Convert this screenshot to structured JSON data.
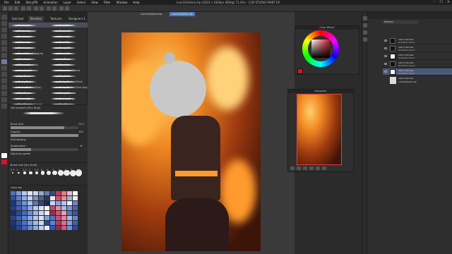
{
  "window": {
    "title": "Lum1024shd.clip (1024 x 1920px 400dpi 71.4%) - CLIP STUDIO PAINT EX",
    "menu": [
      "File",
      "Edit",
      "Story/PS",
      "Animation",
      "Layer",
      "Select",
      "View",
      "Filter",
      "Window",
      "Help"
    ],
    "controls": [
      "–",
      "☐",
      "✕"
    ]
  },
  "document_tabs": [
    {
      "label": "Lum1024shd.clip",
      "active": false
    },
    {
      "label": "Lum1024shd.clip",
      "active": true
    }
  ],
  "subtool": {
    "tabs": [
      "Sub tool",
      "Brushes",
      "Textures",
      "Designers 1"
    ],
    "active_tab": "Brushes",
    "brushes": [
      {
        "left": "Texture",
        "right": "Paint Brush"
      },
      {
        "left": "Flattening pen",
        "right": "Pointed Pen"
      },
      {
        "left": "Rough pen",
        "right": "Gouache"
      },
      {
        "left": "Oil paint",
        "right": "Fine Oil"
      },
      {
        "left": "Textured pen",
        "right": "Rough Pen"
      },
      {
        "left": "Brush Pen (Opaque)",
        "right": "Brush Pen"
      },
      {
        "left": "Brush",
        "right": "Ink Pen"
      },
      {
        "left": "Glossy Scratchy",
        "right": "Dry Ink"
      },
      {
        "left": "Unmixed Dense",
        "right": "Saturated Dense"
      },
      {
        "left": "Dry Gouache",
        "right": "Dry Gum"
      },
      {
        "left": "Dotty Dotter",
        "right": "Dotty Dotter (Fine)"
      },
      {
        "left": "Dotty Dotter (Dyn)",
        "right": "Dotty Dotter (Fine dyn)"
      },
      {
        "left": "Dry Gum",
        "right": "Rough Smear"
      },
      {
        "left": "Smear (Fine)",
        "right": "Smear (Dry)"
      },
      {
        "left": "Dry Blender (Large)",
        "right": "Dry Blender"
      },
      {
        "left": "Dry Dust",
        "right": "Dry Dust"
      }
    ]
  },
  "tool_property": {
    "title": "Tool property [Dry Dust]",
    "brush_size_label": "Brush Size",
    "brush_size_value": "79.2",
    "opacity_label": "Opacity",
    "opacity_value": "100",
    "opacity_level": 1.0,
    "brush_size_level": 0.79,
    "antialias_label": "Anti-aliasing",
    "stabilization_label": "Stabilization",
    "stabilization_value": "8",
    "adjust_label": "Adjust by speed"
  },
  "brush_size_panel": {
    "title": "Brush size [Dry Dust]",
    "sizes": [
      "0.7",
      "1",
      "1.5",
      "2",
      "2.5",
      "3",
      "4",
      "5",
      "6",
      "7",
      "8",
      "10"
    ]
  },
  "color_set": {
    "title": "Color set",
    "colors": [
      "#4e6fbf",
      "#7f9bd8",
      "#b8c9ec",
      "#e0e6f6",
      "#c7d5f0",
      "#9aa8c8",
      "#6b7ba6",
      "#3e4a75",
      "#c23b58",
      "#e07a8f",
      "#f1b8c4",
      "#ffffff",
      "#2f4ea0",
      "#5c7fd0",
      "#8faee6",
      "#bfd3f3",
      "#7a8fc4",
      "#4e5f96",
      "#2a3666",
      "#e0e7f7",
      "#d14f6f",
      "#ef8aa0",
      "#9bb3e6",
      "#eef3fb",
      "#1f3a7a",
      "#4668b5",
      "#6f92d6",
      "#a6c0ed",
      "#5f74b0",
      "#35457e",
      "#1c2750",
      "#c9d6f2",
      "#8aa3dd",
      "#b4c6ee",
      "#e5ecf9",
      "#6c84c7",
      "#293f8c",
      "#3d5dad",
      "#5a7ccb",
      "#8aa6e2",
      "#b6caf0",
      "#d8e3f7",
      "#f0f4fc",
      "#c14b6a",
      "#e28aa0",
      "#a8bcea",
      "#7c95d4",
      "#4d66ae",
      "#1b2f66",
      "#30498f",
      "#4a68b8",
      "#6f8fd3",
      "#9eb6e8",
      "#cdd9f4",
      "#e9eefa",
      "#9b2f4d",
      "#c65a77",
      "#ec9fb3",
      "#5676c1",
      "#3a56a0",
      "#26458f",
      "#3b62b8",
      "#5b83d4",
      "#88a7e3",
      "#b3c8ef",
      "#dde6f8",
      "#7ea0e0",
      "#4e75c6",
      "#d34c78",
      "#f07ea1",
      "#a3b9ec",
      "#6a86cd",
      "#1e3578",
      "#2f52a6",
      "#4d73c9",
      "#739ade",
      "#9fbde9",
      "#c9d8f3",
      "#2846a0",
      "#5f83d3",
      "#b03e62",
      "#e36c91",
      "#86a2e0",
      "#3f60b5",
      "#1a2c63",
      "#2a468f",
      "#4466b6",
      "#6689d0",
      "#8eaee4",
      "#b9cdf0",
      "#e4ebf9",
      "#3758ae",
      "#912c4d",
      "#cc5b7e",
      "#718fd7",
      "#2d4b9d"
    ]
  },
  "color_wheel": {
    "title": "Color Wheel",
    "current_color": "#d4142a"
  },
  "navigator": {
    "title": "Navigator"
  },
  "layers": {
    "blend_mode": "Normal",
    "items": [
      {
        "line1": "100 % Normal",
        "line2": "Gradient map 2",
        "thumb": "black",
        "selected": false
      },
      {
        "line1": "100 % Normal",
        "line2": "Gradient map 3",
        "thumb": "black",
        "selected": false
      },
      {
        "line1": "100 % Normal",
        "line2": "Gradient map 1",
        "thumb": "white",
        "selected": false
      },
      {
        "line1": "100 % Normal",
        "line2": "Gradient map 4",
        "thumb": "black",
        "selected": false
      },
      {
        "line1": "100 % Normal",
        "line2": "Gradient map 4",
        "thumb": "white",
        "selected": true
      }
    ],
    "folder": {
      "line1": "100 % Normal",
      "line2": "Lum1024shd.clip"
    }
  }
}
